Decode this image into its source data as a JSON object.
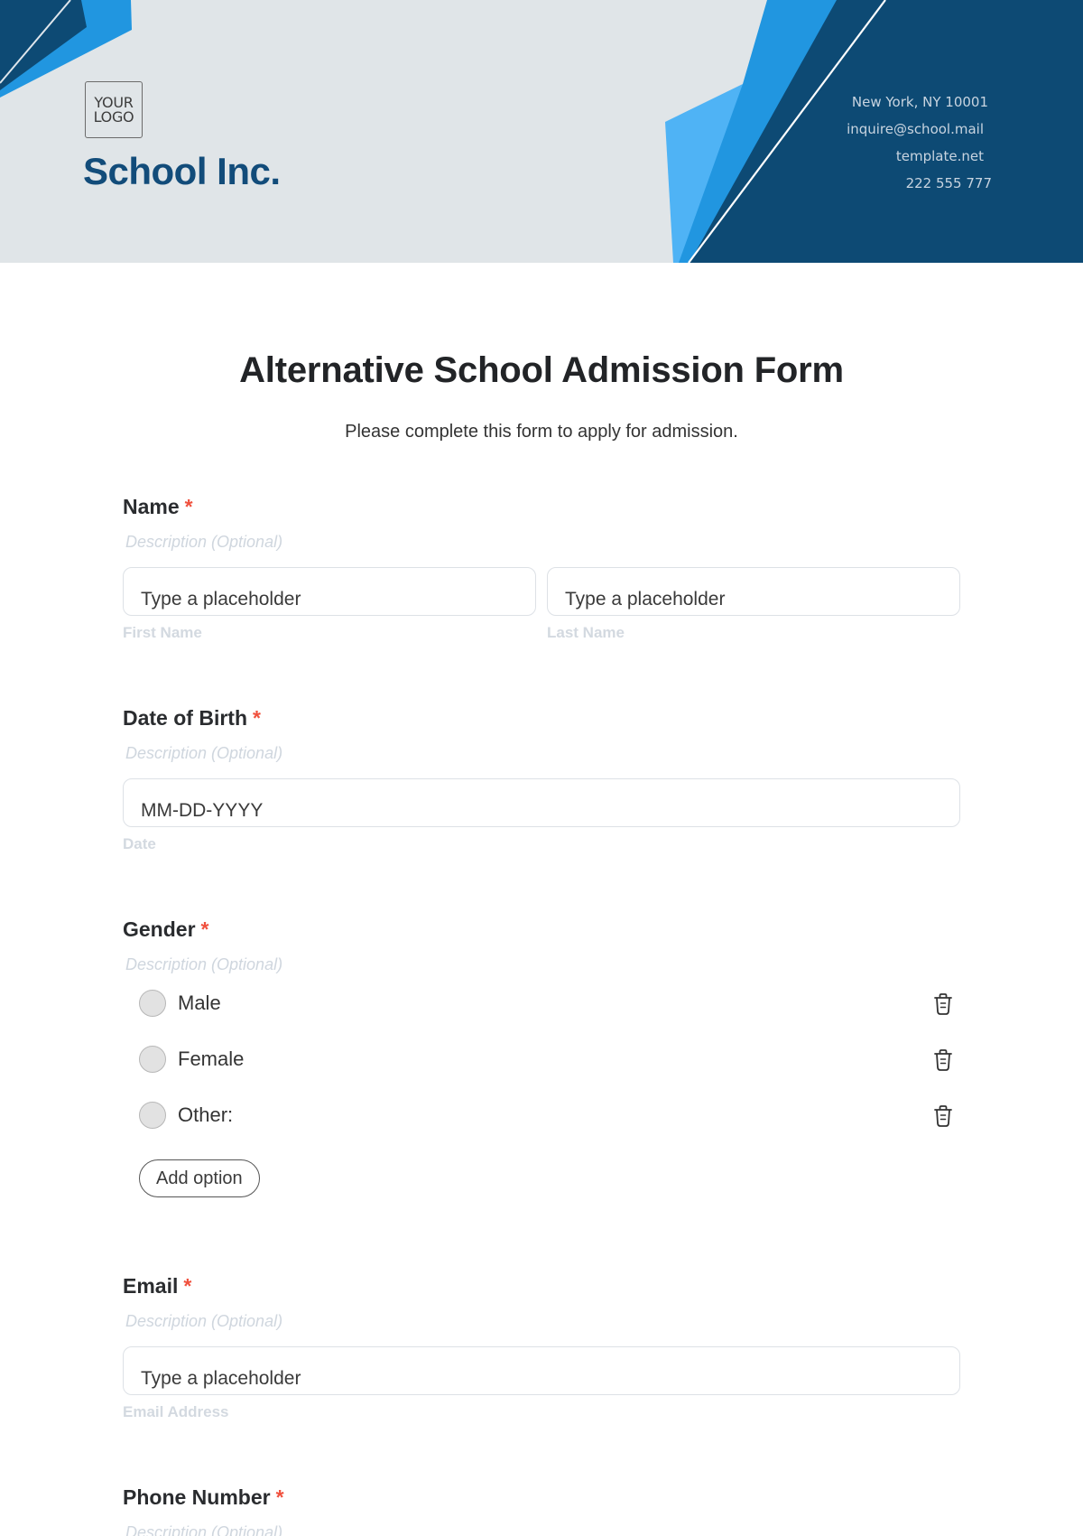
{
  "header": {
    "logo_text": "YOUR\nLOGO",
    "company_name": "School Inc.",
    "contact": {
      "address": "New York, NY 10001",
      "email": "inquire@school.mail",
      "website": "template.net",
      "phone": "222 555 777"
    },
    "colors": {
      "background": "#e0e5e8",
      "navy": "#0d4a74",
      "mid_blue": "#2196e0",
      "light_blue": "#4fb3f5",
      "brand_text": "#124c7a"
    }
  },
  "form": {
    "title": "Alternative School Admission Form",
    "subtitle": "Please complete this form to apply for admission.",
    "required_marker": "*",
    "required_color": "#f0513e",
    "fields": [
      {
        "label": "Name",
        "required": true,
        "description": "Description (Optional)",
        "inputs": [
          {
            "value": "Type a placeholder",
            "sublabel": "First Name"
          },
          {
            "value": "Type a placeholder",
            "sublabel": "Last Name"
          }
        ]
      },
      {
        "label": "Date of Birth",
        "required": true,
        "description": "Description (Optional)",
        "inputs": [
          {
            "value": "MM-DD-YYYY",
            "sublabel": "Date"
          }
        ]
      },
      {
        "label": "Gender",
        "required": true,
        "description": "Description (Optional)",
        "options": [
          {
            "label": "Male",
            "icon": "trash-icon"
          },
          {
            "label": "Female",
            "icon": "trash-icon"
          },
          {
            "label": "Other:",
            "icon": "trash-icon"
          }
        ],
        "add_option_label": "Add option"
      },
      {
        "label": "Email",
        "required": true,
        "description": "Description (Optional)",
        "inputs": [
          {
            "value": "Type a placeholder",
            "sublabel": "Email Address"
          }
        ]
      },
      {
        "label": "Phone Number",
        "required": true,
        "description": "Description (Optional)"
      }
    ]
  }
}
